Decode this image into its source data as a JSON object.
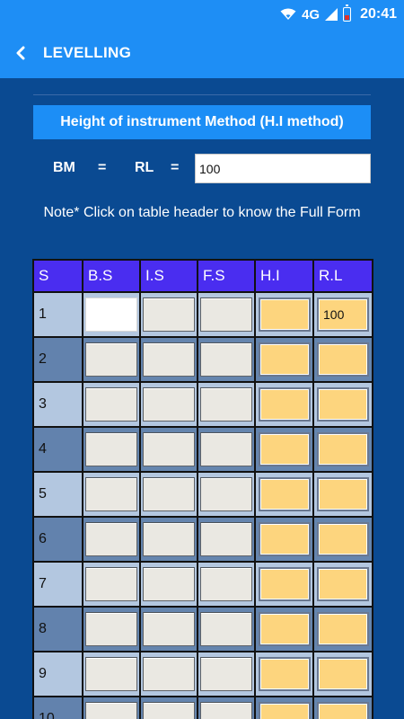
{
  "status_bar": {
    "network": "4G",
    "time": "20:41"
  },
  "app_bar": {
    "title": "LEVELLING",
    "back_icon": "chevron-left-icon"
  },
  "method_banner": "Height of instrument Method (H.I method)",
  "bm_row": {
    "bm_label": "BM",
    "equals1": "=",
    "rl_label": "RL",
    "equals2": "=",
    "rl_value": "100"
  },
  "note": "Note* Click on table header to know the Full Form",
  "table": {
    "headers": [
      "S",
      "B.S",
      "I.S",
      "F.S",
      "H.I",
      "R.L"
    ],
    "rows": [
      {
        "s": "1",
        "bs": "",
        "is": "",
        "fs": "",
        "hi": "",
        "rl": "100"
      },
      {
        "s": "2",
        "bs": "",
        "is": "",
        "fs": "",
        "hi": "",
        "rl": ""
      },
      {
        "s": "3",
        "bs": "",
        "is": "",
        "fs": "",
        "hi": "",
        "rl": ""
      },
      {
        "s": "4",
        "bs": "",
        "is": "",
        "fs": "",
        "hi": "",
        "rl": ""
      },
      {
        "s": "5",
        "bs": "",
        "is": "",
        "fs": "",
        "hi": "",
        "rl": ""
      },
      {
        "s": "6",
        "bs": "",
        "is": "",
        "fs": "",
        "hi": "",
        "rl": ""
      },
      {
        "s": "7",
        "bs": "",
        "is": "",
        "fs": "",
        "hi": "",
        "rl": ""
      },
      {
        "s": "8",
        "bs": "",
        "is": "",
        "fs": "",
        "hi": "",
        "rl": ""
      },
      {
        "s": "9",
        "bs": "",
        "is": "",
        "fs": "",
        "hi": "",
        "rl": ""
      },
      {
        "s": "10",
        "bs": "",
        "is": "",
        "fs": "",
        "hi": "",
        "rl": ""
      }
    ]
  },
  "colors": {
    "app_bar": "#1e8ef5",
    "background": "#0a4a92",
    "header_row": "#4a2df0",
    "row_light": "#b3c7e0",
    "row_dark": "#6585ae",
    "computed_cell": "#fdd57e"
  }
}
